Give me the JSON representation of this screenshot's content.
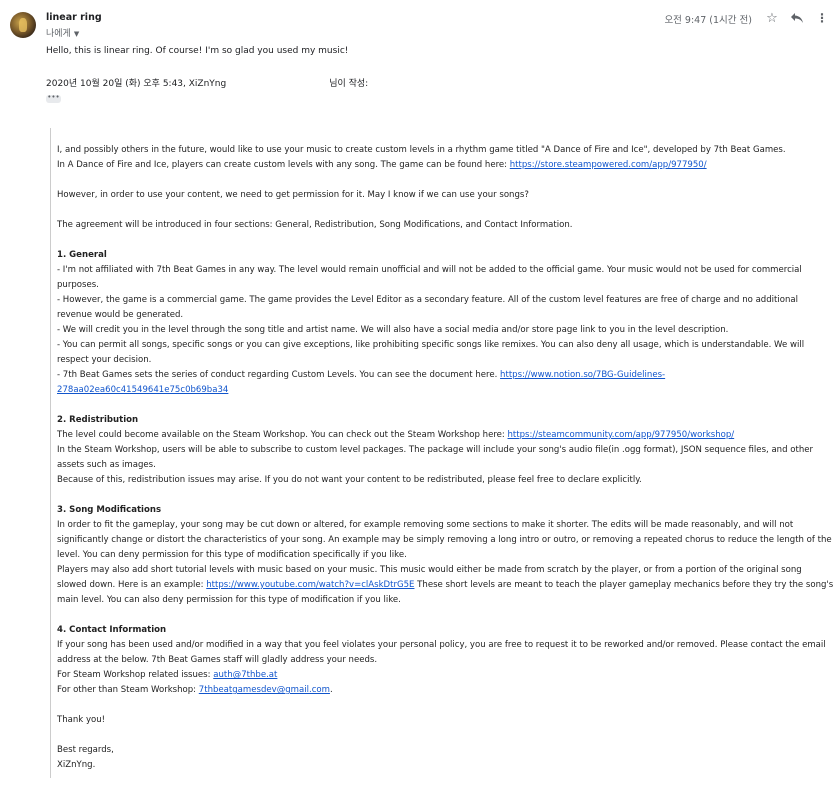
{
  "header": {
    "sender_name": "linear ring",
    "recipient": "나에게",
    "timestamp": "오전 9:47 (1시간 전)"
  },
  "icons": {
    "avatar": "avatar",
    "star": "star-icon",
    "reply": "reply-icon",
    "more": "more-vert-icon",
    "dropdown": "chevron-down-icon"
  },
  "reply": {
    "text": "Hello, this is linear ring. Of course! I'm so glad you used my music!"
  },
  "quote_header": {
    "text": "2020년 10월 20일 (화) 오후 5:43, XiZnYng                                    님이 작성:",
    "ellipsis": "•••"
  },
  "body": {
    "intro1": "I, and possibly others in the future, would like to use your music to create custom levels in a rhythm game titled \"A Dance of Fire and Ice\", developed by 7th Beat Games.",
    "intro2_pre": "In A Dance of Fire and Ice, players can create custom levels with any song. The game can be found here: ",
    "store_link": "https://store.steampowered.com/app/977950/",
    "permission": "However, in order to use your content, we need to get permission for it. May I know if we can use your songs?",
    "agreement": "The agreement will be introduced in four sections: General, Redistribution, Song Modifications, and Contact Information.",
    "sec1_title": "1. General",
    "sec1_l1": "- I'm not affiliated with 7th Beat Games in any way. The level would remain unofficial and will not be added to the official game. Your music would not be used for commercial purposes.",
    "sec1_l2": "- However, the game is a commercial game. The game provides the Level Editor as a secondary feature. All of the custom level features are free of charge and no additional revenue would be generated.",
    "sec1_l3": "- We will credit you in the level through the song title and artist name. We will also have a social media and/or store page link to you in the level description.",
    "sec1_l4": "- You can permit all songs, specific songs or you can give exceptions, like prohibiting specific songs like remixes. You can also deny all usage, which is understandable. We will respect your decision.",
    "sec1_l5_pre": "- 7th Beat Games sets the series of conduct regarding Custom Levels. You can see the document here. ",
    "guidelines_link": "https://www.notion.so/7BG-Guidelines-278aa02ea60c41549641e75c0b69ba34",
    "sec2_title": "2. Redistribution",
    "sec2_l1_pre": "The level could become available on the Steam Workshop. You can check out the Steam Workshop here: ",
    "workshop_link": "https://steamcommunity.com/app/977950/workshop/",
    "sec2_l2": "In the Steam Workshop, users will be able to subscribe to custom level packages. The package will include your song's audio file(in .ogg format), JSON sequence files, and other assets such as images.",
    "sec2_l3": "Because of this, redistribution issues may arise. If you do not want your content to be redistributed, please feel free to declare explicitly.",
    "sec3_title": "3. Song Modifications",
    "sec3_l1": "In order to fit the gameplay, your song may be cut down or altered, for example removing some sections to make it shorter. The edits will be made reasonably, and will not significantly change or distort the characteristics of your song. An example may be simply removing a long intro or outro, or removing a repeated chorus to reduce the length of the level. You can deny permission for this type of modification specifically if you like.",
    "sec3_l2_pre": "Players may also add short tutorial levels with music based on your music. This music would either be made from scratch by the player, or from a portion of the original song slowed down. Here is an example: ",
    "youtube_link": "https://www.youtube.com/watch?v=clAskDtrG5E",
    "sec3_l2_post": " These short levels are meant to teach the player gameplay mechanics before they try the song's main level. You can also deny permission for this type of modification if you like.",
    "sec4_title": "4. Contact Information",
    "sec4_l1": "If your song has been used and/or modified in a way that you feel violates your personal policy, you are free to request it to be reworked and/or removed. Please contact the email address at the below. 7th Beat Games staff will gladly address your needs.",
    "sec4_l2_pre": "For Steam Workshop related issues: ",
    "auth_email": "auth@7thbe.at",
    "sec4_l3_pre": "For other than Steam Workshop: ",
    "dev_email": "7thbeatgamesdev@gmail.com",
    "sec4_l3_post": ".",
    "thanks": "Thank you!",
    "regards": "Best regards,",
    "signature": "XiZnYng."
  }
}
